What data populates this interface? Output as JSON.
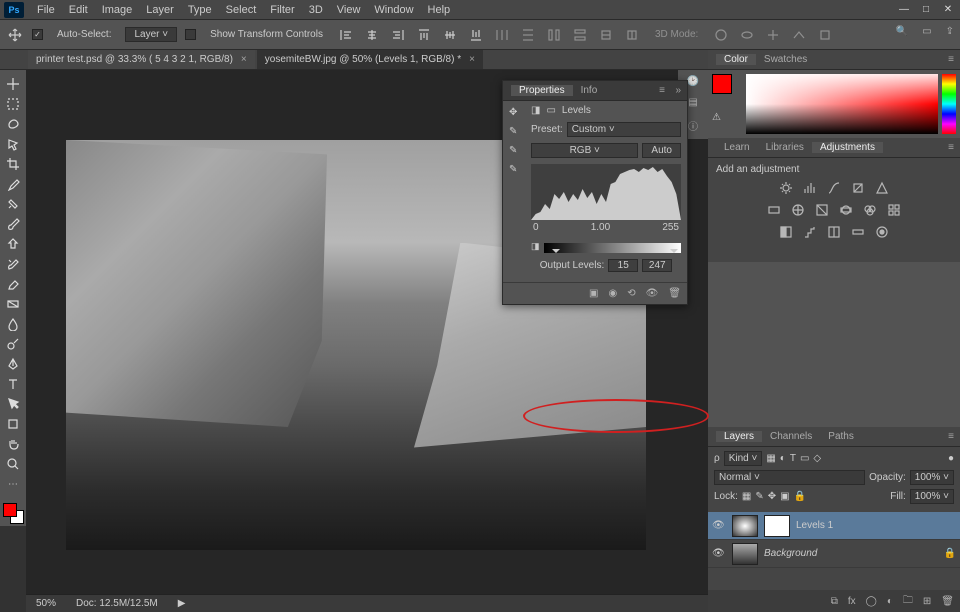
{
  "app": {
    "name": "Ps"
  },
  "menu": [
    "File",
    "Edit",
    "Image",
    "Layer",
    "Type",
    "Select",
    "Filter",
    "3D",
    "View",
    "Window",
    "Help"
  ],
  "options": {
    "auto_select": "Auto-Select:",
    "target": "Layer",
    "show_transform": "Show Transform Controls",
    "mode3d": "3D Mode:"
  },
  "tabs": [
    {
      "title": "printer test.psd @ 33.3% (   5          4        3       2      1, RGB/8)",
      "close": "×"
    },
    {
      "title": "yosemiteBW.jpg @ 50% (Levels 1, RGB/8) *",
      "close": "×"
    }
  ],
  "status": {
    "zoom": "50%",
    "doc": "Doc: 12.5M/12.5M",
    "arrow": "▶"
  },
  "color": {
    "tab1": "Color",
    "tab2": "Swatches",
    "fg": "#ff0000",
    "bg": "#ffffff"
  },
  "adjust": {
    "tab1": "Learn",
    "tab2": "Libraries",
    "tab3": "Adjustments",
    "head": "Add an adjustment"
  },
  "layers": {
    "tab1": "Layers",
    "tab2": "Channels",
    "tab3": "Paths",
    "kind": "Kind",
    "normal": "Normal",
    "opacity": "Opacity:",
    "opv": "100%",
    "lock": "Lock:",
    "fill": "Fill:",
    "fillv": "100%",
    "rows": [
      {
        "name": "Levels 1"
      },
      {
        "name": "Background"
      }
    ],
    "foot_fx": "fx"
  },
  "properties": {
    "tab1": "Properties",
    "tab2": "Info",
    "title": "Levels",
    "preset_lbl": "Preset:",
    "preset": "Custom",
    "channel": "RGB",
    "auto": "Auto",
    "in_black": "0",
    "in_gamma": "1.00",
    "in_white": "255",
    "out_lbl": "Output Levels:",
    "out_black": "15",
    "out_white": "247"
  }
}
